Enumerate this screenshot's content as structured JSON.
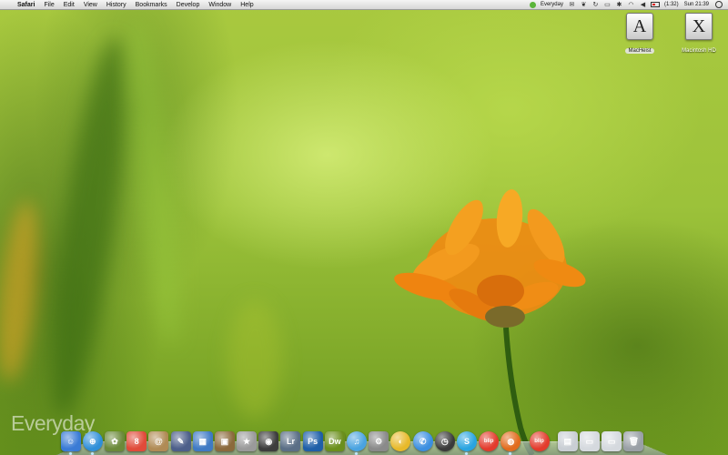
{
  "menubar": {
    "app_name": "Safari",
    "items": [
      "File",
      "Edit",
      "View",
      "History",
      "Bookmarks",
      "Develop",
      "Window",
      "Help"
    ],
    "status_app": "Everyday",
    "battery": "(1:32)",
    "clock": "Sun 21:39"
  },
  "desktop_icons": [
    {
      "label": "MacHeist",
      "glyph": "A"
    },
    {
      "label": "Macintosh HD",
      "glyph": "X"
    }
  ],
  "watermark": "Everyday",
  "dock": {
    "items": [
      {
        "name": "finder",
        "glyph": "☺",
        "color": "#3a7bd5",
        "round": false
      },
      {
        "name": "safari",
        "glyph": "⊕",
        "color": "#2f8fd8",
        "round": true
      },
      {
        "name": "iphoto",
        "glyph": "✿",
        "color": "#6b8a3a",
        "round": false
      },
      {
        "name": "ical",
        "glyph": "8",
        "color": "#e04b3a",
        "round": false
      },
      {
        "name": "address-book",
        "glyph": "@",
        "color": "#b08b55",
        "round": false
      },
      {
        "name": "pen-app",
        "glyph": "✎",
        "color": "#4d5f8a",
        "round": false
      },
      {
        "name": "chart-app",
        "glyph": "▦",
        "color": "#3f7ac4",
        "round": false
      },
      {
        "name": "preview",
        "glyph": "▣",
        "color": "#8b6a3c",
        "round": false
      },
      {
        "name": "star-app",
        "glyph": "★",
        "color": "#9a9a9a",
        "round": false
      },
      {
        "name": "photo-booth",
        "glyph": "◉",
        "color": "#3d3d3d",
        "round": false
      },
      {
        "name": "lightroom",
        "glyph": "Lr",
        "color": "#5b6f86",
        "round": false
      },
      {
        "name": "photoshop",
        "glyph": "Ps",
        "color": "#1f5fa8",
        "round": false
      },
      {
        "name": "dreamweaver",
        "glyph": "Dw",
        "color": "#6b8f1c",
        "round": false
      },
      {
        "name": "itunes",
        "glyph": "♫",
        "color": "#4aa3e0",
        "round": true
      },
      {
        "name": "script-app",
        "glyph": "⚙",
        "color": "#8a8a8a",
        "round": false
      },
      {
        "name": "adium",
        "glyph": "◐",
        "color": "#e7b92a",
        "round": true
      },
      {
        "name": "ichat",
        "glyph": "✆",
        "color": "#3b8fe0",
        "round": true
      },
      {
        "name": "time-machine",
        "glyph": "◷",
        "color": "#3a3a3a",
        "round": true
      },
      {
        "name": "skype",
        "glyph": "S",
        "color": "#29a4e0",
        "round": true
      },
      {
        "name": "blip",
        "glyph": "blip",
        "color": "#e33b2c",
        "round": true
      },
      {
        "name": "firefox",
        "glyph": "◍",
        "color": "#e26b1d",
        "round": true
      },
      {
        "name": "blip-2",
        "glyph": "blip",
        "color": "#e33b2c",
        "round": true
      },
      {
        "name": "document",
        "glyph": "▤",
        "color": "#c9ced4",
        "round": false
      },
      {
        "name": "window-1",
        "glyph": "▭",
        "color": "#d5d9de",
        "round": false
      },
      {
        "name": "window-2",
        "glyph": "▭",
        "color": "#d5d9de",
        "round": false
      },
      {
        "name": "trash",
        "glyph": "🗑",
        "color": "#9aa0a6",
        "round": false
      }
    ]
  }
}
